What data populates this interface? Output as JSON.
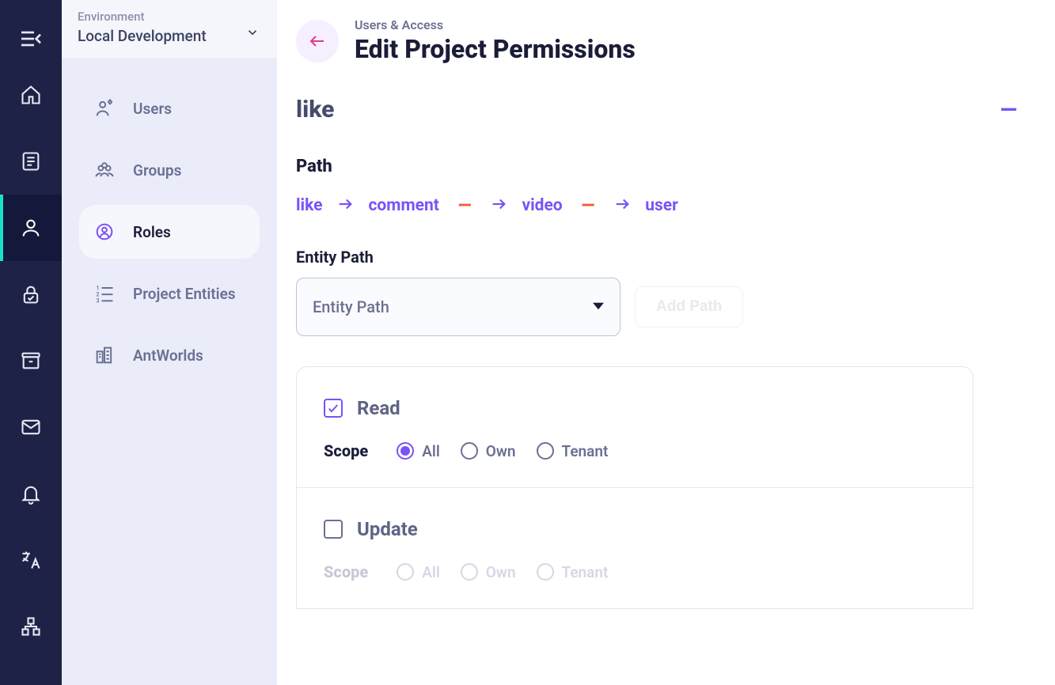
{
  "environment": {
    "label": "Environment",
    "value": "Local Development"
  },
  "sidebar": {
    "items": [
      {
        "label": "Users"
      },
      {
        "label": "Groups"
      },
      {
        "label": "Roles"
      },
      {
        "label": "Project Entities"
      },
      {
        "label": "AntWorlds"
      }
    ]
  },
  "header": {
    "crumb": "Users & Access",
    "title": "Edit Project Permissions"
  },
  "section": {
    "title": "like",
    "collapse_glyph": "—"
  },
  "path": {
    "heading": "Path",
    "chain": [
      "like",
      "comment",
      "video",
      "user"
    ],
    "remove_glyph": "—"
  },
  "entity_path": {
    "label": "Entity Path",
    "placeholder": "Entity Path",
    "add_button": "Add Path"
  },
  "permissions": {
    "scope_label": "Scope",
    "scope_options": [
      "All",
      "Own",
      "Tenant"
    ],
    "blocks": [
      {
        "name": "Read",
        "checked": true,
        "enabled": true,
        "scope_selected": 0
      },
      {
        "name": "Update",
        "checked": false,
        "enabled": false,
        "scope_selected": -1
      }
    ]
  }
}
